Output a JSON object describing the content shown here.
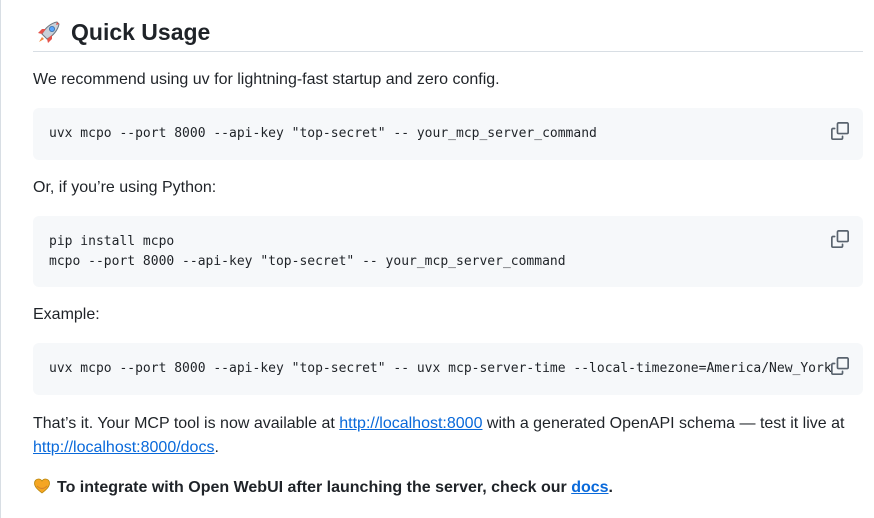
{
  "heading": {
    "title": "Quick Usage"
  },
  "intro": "We recommend using uv for lightning-fast startup and zero config.",
  "code1": {
    "line1": "uvx mcpo --port 8000 --api-key \"top-secret\" -- your_mcp_server_command"
  },
  "python_note": "Or, if you’re using Python:",
  "code2": {
    "line1": "pip install mcpo",
    "line2": "mcpo --port 8000 --api-key \"top-secret\" -- your_mcp_server_command"
  },
  "example_label": "Example:",
  "code3": {
    "line1": "uvx mcpo --port 8000 --api-key \"top-secret\" -- uvx mcp-server-time --local-timezone=America/New_York"
  },
  "result": {
    "text1": "That’s it. Your MCP tool is now available at ",
    "link1": "http://localhost:8000",
    "text2": " with a generated OpenAPI schema — test it live at ",
    "link2": "http://localhost:8000/docs",
    "text3": "."
  },
  "integrate": {
    "text": "To integrate with Open WebUI after launching the server, check our ",
    "link": "docs",
    "end": "."
  },
  "colors": {
    "link": "#0969da",
    "code_bg": "#f6f8fa",
    "text": "#1f2328",
    "icon": "#59636e"
  }
}
